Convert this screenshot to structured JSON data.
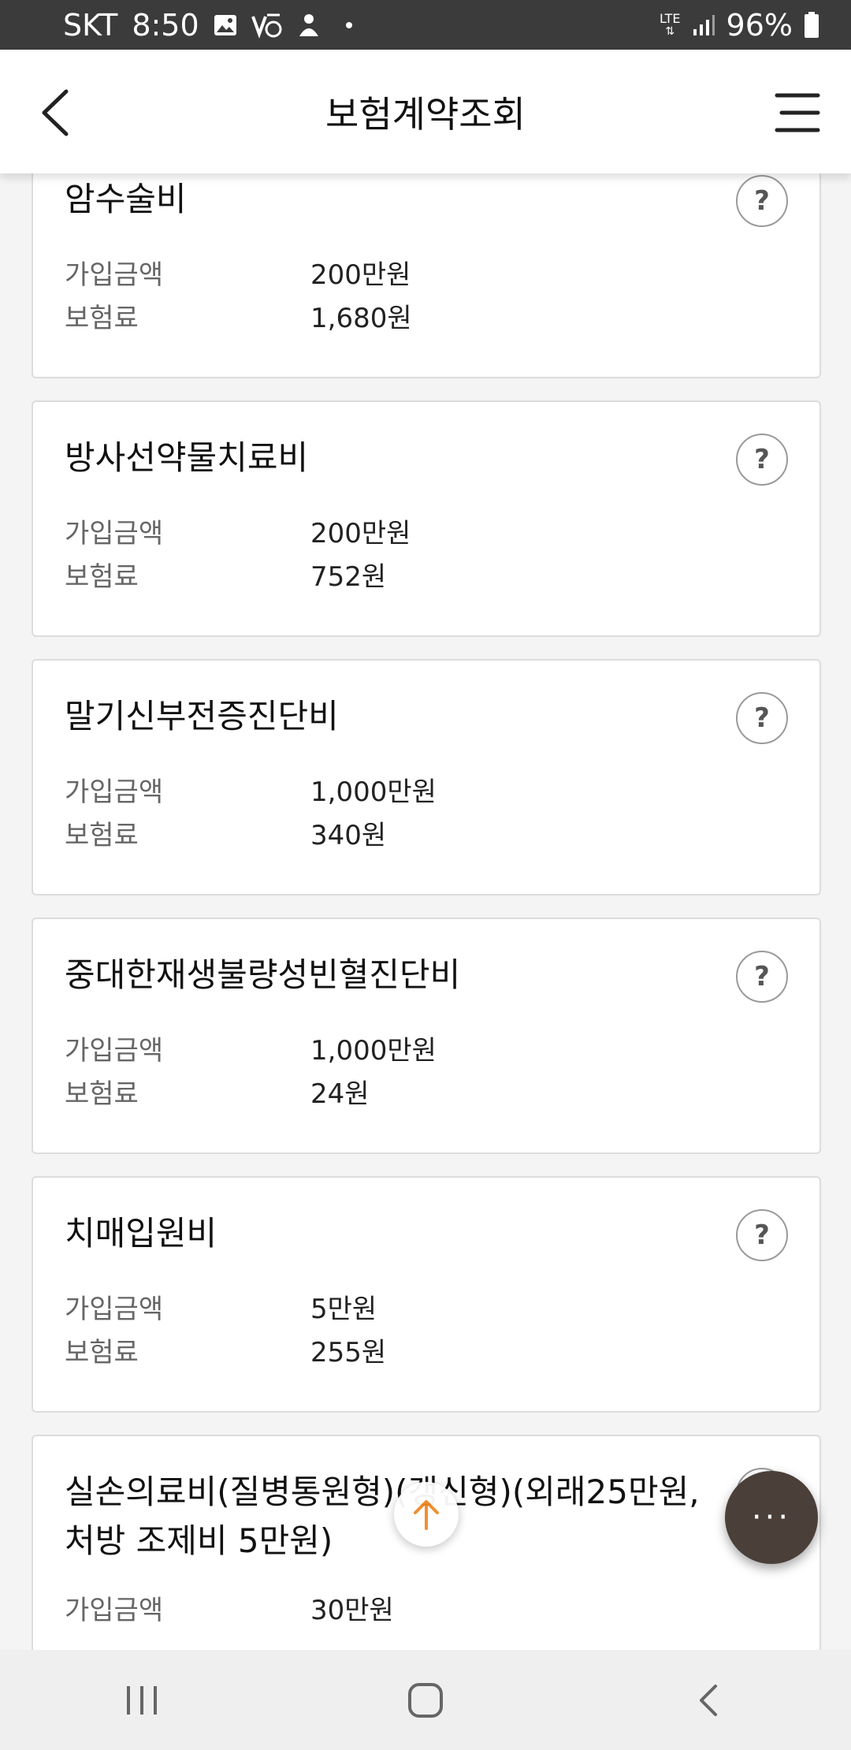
{
  "status_bar": {
    "carrier": "SKT",
    "time": "8:50",
    "network": "LTE",
    "battery": "96%",
    "icons": [
      "image-icon",
      "volte-icon",
      "app-notification-icon",
      "more-dot-icon",
      "signal-icon",
      "battery-icon"
    ]
  },
  "header": {
    "title": "보험계약조회",
    "back_icon": "back-arrow-icon",
    "menu_icon": "hamburger-menu-icon"
  },
  "labels": {
    "amount": "가입금액",
    "premium": "보험료"
  },
  "coverages": [
    {
      "name": "암수술비",
      "amount": "200만원",
      "premium": "1,680원"
    },
    {
      "name": "방사선약물치료비",
      "amount": "200만원",
      "premium": "752원"
    },
    {
      "name": "말기신부전증진단비",
      "amount": "1,000만원",
      "premium": "340원"
    },
    {
      "name": "중대한재생불량성빈혈진단비",
      "amount": "1,000만원",
      "premium": "24원"
    },
    {
      "name": "치매입원비",
      "amount": "5만원",
      "premium": "255원"
    },
    {
      "name": "실손의료비(질병통원형)(갱신형)(외래25만원, 처방 조제비 5만원)",
      "amount": "30만원"
    }
  ],
  "help_glyph": "?",
  "floating": {
    "scroll_top_icon": "arrow-up-icon",
    "fab_icon": "more-horizontal-icon",
    "fab_label": "···"
  },
  "nav": {
    "icons": [
      "recent-apps-icon",
      "home-icon",
      "back-icon"
    ]
  },
  "colors": {
    "accent": "#f08a24",
    "fab": "#4a3f39",
    "status_bar": "#3b3b3b"
  }
}
